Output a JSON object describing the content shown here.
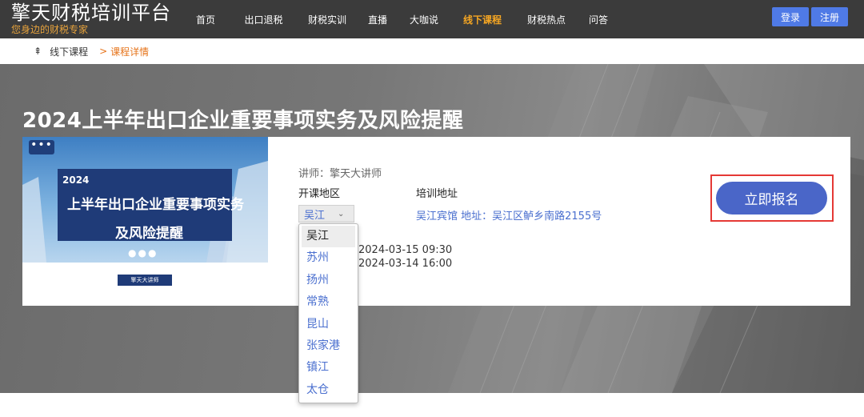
{
  "brand": {
    "title": "擎天财税培训平台",
    "subtitle": "您身边的财税专家"
  },
  "nav": [
    {
      "label": "首页",
      "active": false
    },
    {
      "label": "出口退税",
      "active": false
    },
    {
      "label": "财税实训",
      "active": false
    },
    {
      "label": "直播",
      "active": false
    },
    {
      "label": "大咖说",
      "active": false
    },
    {
      "label": "线下课程",
      "active": true
    },
    {
      "label": "财税热点",
      "active": false
    },
    {
      "label": "问答",
      "active": false
    }
  ],
  "auth": {
    "login": "登录",
    "register": "注册"
  },
  "breadcrumb": {
    "parent": "线下课程",
    "separator": ">",
    "current": "课程详情"
  },
  "course": {
    "title": "2024上半年出口企业重要事项实务及风险提醒",
    "cover": {
      "year": "2024",
      "line1": "上半年出口企业重要事项实务",
      "line2": "及风险提醒",
      "badge": "擎天大讲师"
    },
    "teacher": "讲师：擎天大讲师",
    "region_label": "开课地区",
    "address_label": "培训地址",
    "address_value": "吴江宾馆 地址：吴江区鲈乡南路2155号",
    "time_1": "2024-03-15 09:30",
    "time_2": "2024-03-14 16:00",
    "signup_label": "立即报名"
  },
  "region_select": {
    "selected": "吴江",
    "options": [
      "吴江",
      "苏州",
      "扬州",
      "常熟",
      "昆山",
      "张家港",
      "镇江",
      "太仓"
    ]
  },
  "colors": {
    "topbar": "#3b3b3b",
    "accent": "#4a66c8",
    "active_nav": "#f5a623",
    "highlight_box": "#e53935"
  }
}
